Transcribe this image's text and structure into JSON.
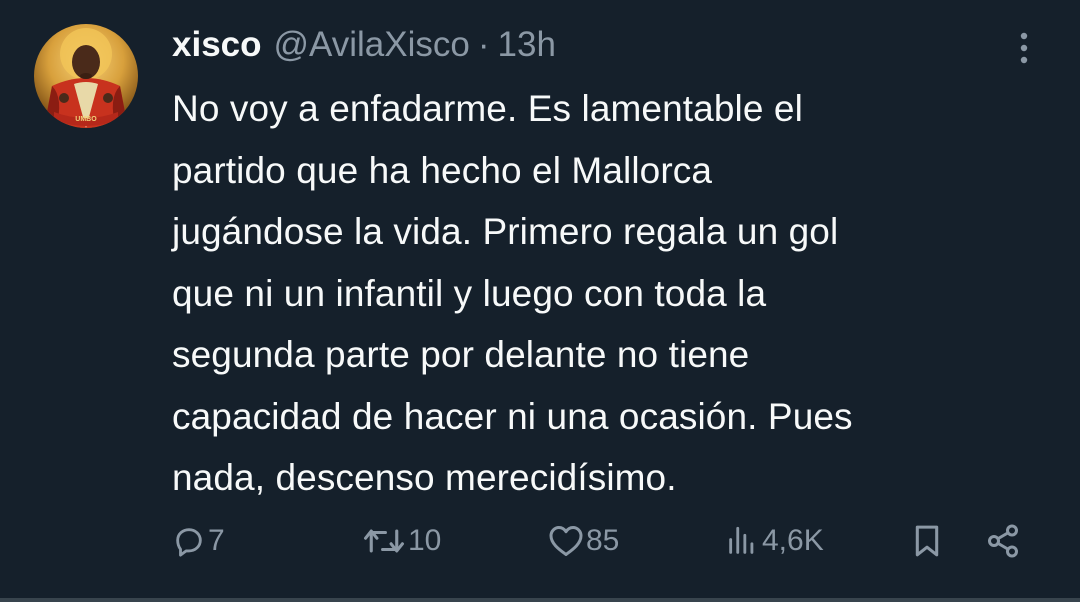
{
  "tweet": {
    "display_name": "xisco",
    "handle": "@AvilaXisco",
    "separator": "·",
    "time": "13h",
    "avatar_caption": "UMBO",
    "text": "No voy a enfadarme. Es lamentable el\npartido que ha hecho el Mallorca\njugándose la vida. Primero regala un gol\nque ni un infantil y luego con toda la\nsegunda parte por delante no tiene\ncapacidad de hacer ni una ocasión. Pues\nnada, descenso merecidísimo.",
    "actions": {
      "replies": "7",
      "reposts": "10",
      "likes": "85",
      "views": "4,6K"
    }
  },
  "icons": {
    "more": "more-vertical-icon",
    "reply": "reply-icon",
    "repost": "repost-icon",
    "like": "heart-icon",
    "views": "views-icon",
    "bookmark": "bookmark-icon",
    "share": "share-icon"
  },
  "colors": {
    "background": "#15202b",
    "text_primary": "#f7f9f9",
    "text_secondary": "#8b98a5"
  }
}
